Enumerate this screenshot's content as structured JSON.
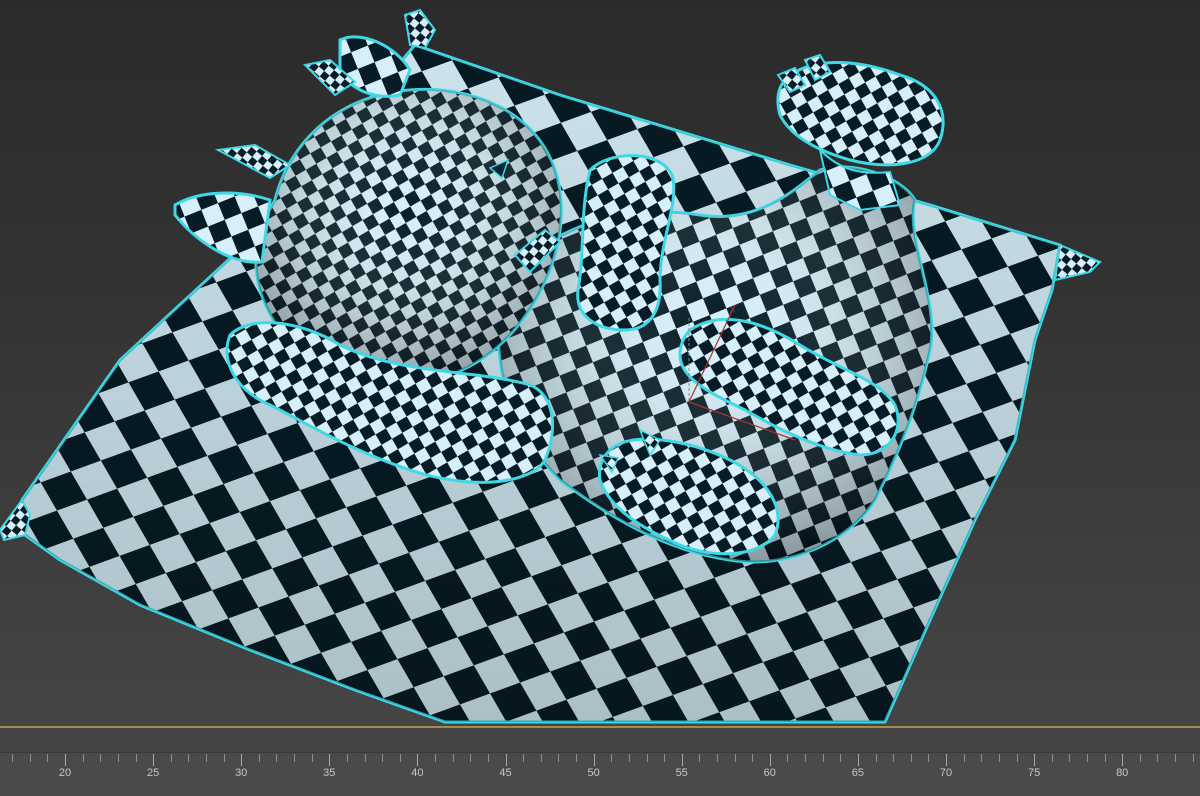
{
  "viewport": {
    "subject": "dog-on-pillow-checker-uv",
    "checker_light": "#d6eff8",
    "checker_dark": "#071c26",
    "selection_outline": "#3fd8e6",
    "axis_x_color": "#b03030",
    "axis_y_color": "#8a8a8a"
  },
  "timeline": {
    "track_color": "#a7884d",
    "ruler_labels": [
      "20",
      "25",
      "30",
      "35",
      "40",
      "45",
      "50",
      "55",
      "60",
      "65",
      "70",
      "75",
      "80"
    ]
  }
}
